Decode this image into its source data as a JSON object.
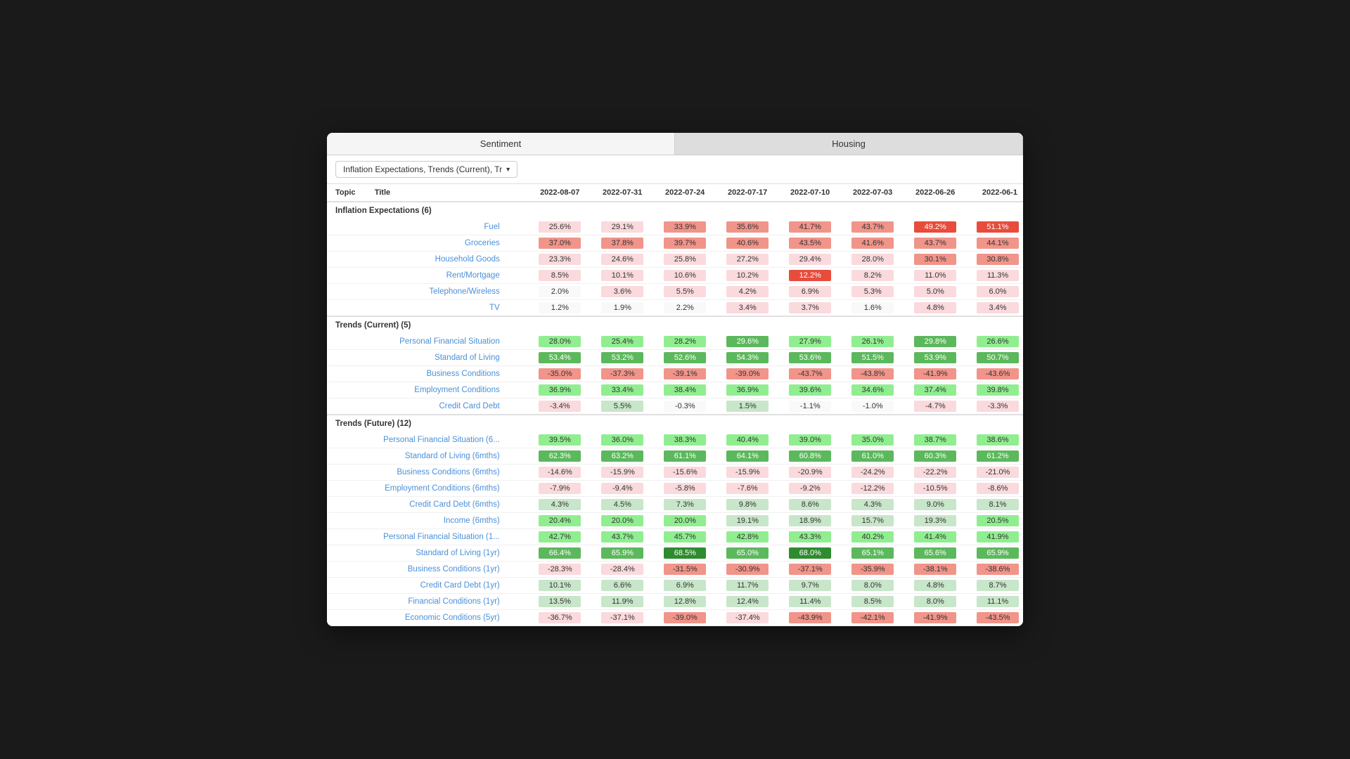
{
  "window": {
    "tabs": [
      {
        "label": "Sentiment",
        "active": true
      },
      {
        "label": "Housing",
        "active": false
      }
    ],
    "dropdown": {
      "label": "Inflation Expectations, Trends (Current), Tr"
    },
    "table": {
      "columns": [
        "Topic",
        "Title",
        "2022-08-07",
        "2022-07-31",
        "2022-07-24",
        "2022-07-17",
        "2022-07-10",
        "2022-07-03",
        "2022-06-26",
        "2022-06-1"
      ],
      "sections": [
        {
          "name": "Inflation Expectations (6)",
          "rows": [
            {
              "title": "Fuel",
              "values": [
                "25.6%",
                "29.1%",
                "33.9%",
                "35.6%",
                "41.7%",
                "43.7%",
                "49.2%",
                "51.1%"
              ],
              "types": [
                "neg-vlight",
                "neg-vlight",
                "neg-light",
                "neg-light",
                "neg-light",
                "neg-light",
                "neg-med",
                "neg-med"
              ]
            },
            {
              "title": "Groceries",
              "values": [
                "37.0%",
                "37.8%",
                "39.7%",
                "40.6%",
                "43.5%",
                "41.6%",
                "43.7%",
                "44.1%"
              ],
              "types": [
                "neg-light",
                "neg-light",
                "neg-light",
                "neg-light",
                "neg-light",
                "neg-light",
                "neg-light",
                "neg-light"
              ]
            },
            {
              "title": "Household Goods",
              "values": [
                "23.3%",
                "24.6%",
                "25.8%",
                "27.2%",
                "29.4%",
                "28.0%",
                "30.1%",
                "30.8%"
              ],
              "types": [
                "neg-vlight",
                "neg-vlight",
                "neg-vlight",
                "neg-vlight",
                "neg-vlight",
                "neg-vlight",
                "neg-light",
                "neg-light"
              ]
            },
            {
              "title": "Rent/Mortgage",
              "values": [
                "8.5%",
                "10.1%",
                "10.6%",
                "10.2%",
                "12.2%",
                "8.2%",
                "11.0%",
                "11.3%"
              ],
              "types": [
                "neg-vlight",
                "neg-vlight",
                "neg-vlight",
                "neg-vlight",
                "neg-med",
                "neg-vlight",
                "neg-vlight",
                "neg-vlight"
              ]
            },
            {
              "title": "Telephone/Wireless",
              "values": [
                "2.0%",
                "3.6%",
                "5.5%",
                "4.2%",
                "6.9%",
                "5.3%",
                "5.0%",
                "6.0%"
              ],
              "types": [
                "neutral",
                "neg-vlight",
                "neg-vlight",
                "neg-vlight",
                "neg-vlight",
                "neg-vlight",
                "neg-vlight",
                "neg-vlight"
              ]
            },
            {
              "title": "TV",
              "values": [
                "1.2%",
                "1.9%",
                "2.2%",
                "3.4%",
                "3.7%",
                "1.6%",
                "4.8%",
                "3.4%"
              ],
              "types": [
                "neutral",
                "neutral",
                "neutral",
                "neg-vlight",
                "neg-vlight",
                "neutral",
                "neg-vlight",
                "neg-vlight"
              ]
            }
          ]
        },
        {
          "name": "Trends (Current) (5)",
          "rows": [
            {
              "title": "Personal Financial Situation",
              "values": [
                "28.0%",
                "25.4%",
                "28.2%",
                "29.6%",
                "27.9%",
                "26.1%",
                "29.8%",
                "26.6%"
              ],
              "types": [
                "pos-light",
                "pos-light",
                "pos-light",
                "pos-med",
                "pos-light",
                "pos-light",
                "pos-med",
                "pos-light"
              ]
            },
            {
              "title": "Standard of Living",
              "values": [
                "53.4%",
                "53.2%",
                "52.6%",
                "54.3%",
                "53.6%",
                "51.5%",
                "53.9%",
                "50.7%"
              ],
              "types": [
                "pos-med",
                "pos-med",
                "pos-med",
                "pos-med",
                "pos-med",
                "pos-med",
                "pos-med",
                "pos-med"
              ]
            },
            {
              "title": "Business Conditions",
              "values": [
                "-35.0%",
                "-37.3%",
                "-39.1%",
                "-39.0%",
                "-43.7%",
                "-43.8%",
                "-41.9%",
                "-43.6%"
              ],
              "types": [
                "neg-light",
                "neg-light",
                "neg-light",
                "neg-light",
                "neg-light",
                "neg-light",
                "neg-light",
                "neg-light"
              ]
            },
            {
              "title": "Employment Conditions",
              "values": [
                "36.9%",
                "33.4%",
                "38.4%",
                "36.9%",
                "39.6%",
                "34.6%",
                "37.4%",
                "39.8%"
              ],
              "types": [
                "pos-light",
                "pos-light",
                "pos-light",
                "pos-light",
                "pos-light",
                "pos-light",
                "pos-light",
                "pos-light"
              ]
            },
            {
              "title": "Credit Card Debt",
              "values": [
                "-3.4%",
                "5.5%",
                "-0.3%",
                "1.5%",
                "-1.1%",
                "-1.0%",
                "-4.7%",
                "-3.3%"
              ],
              "types": [
                "neg-vlight",
                "pos-vlight",
                "neutral",
                "pos-vlight",
                "neutral",
                "neutral",
                "neg-vlight",
                "neg-vlight"
              ]
            }
          ]
        },
        {
          "name": "Trends (Future) (12)",
          "rows": [
            {
              "title": "Personal Financial Situation (6...",
              "values": [
                "39.5%",
                "36.0%",
                "38.3%",
                "40.4%",
                "39.0%",
                "35.0%",
                "38.7%",
                "38.6%"
              ],
              "types": [
                "pos-light",
                "pos-light",
                "pos-light",
                "pos-light",
                "pos-light",
                "pos-light",
                "pos-light",
                "pos-light"
              ]
            },
            {
              "title": "Standard of Living (6mths)",
              "values": [
                "62.3%",
                "63.2%",
                "61.1%",
                "64.1%",
                "60.8%",
                "61.0%",
                "60.3%",
                "61.2%"
              ],
              "types": [
                "pos-med",
                "pos-med",
                "pos-med",
                "pos-med",
                "pos-med",
                "pos-med",
                "pos-med",
                "pos-med"
              ]
            },
            {
              "title": "Business Conditions (6mths)",
              "values": [
                "-14.6%",
                "-15.9%",
                "-15.6%",
                "-15.9%",
                "-20.9%",
                "-24.2%",
                "-22.2%",
                "-21.0%"
              ],
              "types": [
                "neg-vlight",
                "neg-vlight",
                "neg-vlight",
                "neg-vlight",
                "neg-vlight",
                "neg-vlight",
                "neg-vlight",
                "neg-vlight"
              ]
            },
            {
              "title": "Employment Conditions (6mths)",
              "values": [
                "-7.9%",
                "-9.4%",
                "-5.8%",
                "-7.6%",
                "-9.2%",
                "-12.2%",
                "-10.5%",
                "-8.6%"
              ],
              "types": [
                "neg-vlight",
                "neg-vlight",
                "neg-vlight",
                "neg-vlight",
                "neg-vlight",
                "neg-vlight",
                "neg-vlight",
                "neg-vlight"
              ]
            },
            {
              "title": "Credit Card Debt (6mths)",
              "values": [
                "4.3%",
                "4.5%",
                "7.3%",
                "9.8%",
                "8.6%",
                "4.3%",
                "9.0%",
                "8.1%"
              ],
              "types": [
                "pos-vlight",
                "pos-vlight",
                "pos-vlight",
                "pos-vlight",
                "pos-vlight",
                "pos-vlight",
                "pos-vlight",
                "pos-vlight"
              ]
            },
            {
              "title": "Income (6mths)",
              "values": [
                "20.4%",
                "20.0%",
                "20.0%",
                "19.1%",
                "18.9%",
                "15.7%",
                "19.3%",
                "20.5%"
              ],
              "types": [
                "pos-light",
                "pos-light",
                "pos-light",
                "pos-vlight",
                "pos-vlight",
                "pos-vlight",
                "pos-vlight",
                "pos-light"
              ]
            },
            {
              "title": "Personal Financial Situation (1...",
              "values": [
                "42.7%",
                "43.7%",
                "45.7%",
                "42.8%",
                "43.3%",
                "40.2%",
                "41.4%",
                "41.9%"
              ],
              "types": [
                "pos-light",
                "pos-light",
                "pos-light",
                "pos-light",
                "pos-light",
                "pos-light",
                "pos-light",
                "pos-light"
              ]
            },
            {
              "title": "Standard of Living (1yr)",
              "values": [
                "66.4%",
                "65.9%",
                "68.5%",
                "65.0%",
                "68.0%",
                "65.1%",
                "65.6%",
                "65.9%"
              ],
              "types": [
                "pos-med",
                "pos-med",
                "pos-strong",
                "pos-med",
                "pos-strong",
                "pos-med",
                "pos-med",
                "pos-med"
              ]
            },
            {
              "title": "Business Conditions (1yr)",
              "values": [
                "-28.3%",
                "-28.4%",
                "-31.5%",
                "-30.9%",
                "-37.1%",
                "-35.9%",
                "-38.1%",
                "-38.6%"
              ],
              "types": [
                "neg-vlight",
                "neg-vlight",
                "neg-light",
                "neg-light",
                "neg-light",
                "neg-light",
                "neg-light",
                "neg-light"
              ]
            },
            {
              "title": "Credit Card Debt (1yr)",
              "values": [
                "10.1%",
                "6.6%",
                "6.9%",
                "11.7%",
                "9.7%",
                "8.0%",
                "4.8%",
                "8.7%"
              ],
              "types": [
                "pos-vlight",
                "pos-vlight",
                "pos-vlight",
                "pos-vlight",
                "pos-vlight",
                "pos-vlight",
                "pos-vlight",
                "pos-vlight"
              ]
            },
            {
              "title": "Financial Conditions (1yr)",
              "values": [
                "13.5%",
                "11.9%",
                "12.8%",
                "12.4%",
                "11.4%",
                "8.5%",
                "8.0%",
                "11.1%"
              ],
              "types": [
                "pos-vlight",
                "pos-vlight",
                "pos-vlight",
                "pos-vlight",
                "pos-vlight",
                "pos-vlight",
                "pos-vlight",
                "pos-vlight"
              ]
            },
            {
              "title": "Economic Conditions (5yr)",
              "values": [
                "-36.7%",
                "-37.1%",
                "-39.0%",
                "-37.4%",
                "-43.9%",
                "-42.1%",
                "-41.9%",
                "-43.5%"
              ],
              "types": [
                "neg-vlight",
                "neg-vlight",
                "neg-light",
                "neg-vlight",
                "neg-light",
                "neg-light",
                "neg-light",
                "neg-light"
              ]
            }
          ]
        }
      ]
    }
  }
}
